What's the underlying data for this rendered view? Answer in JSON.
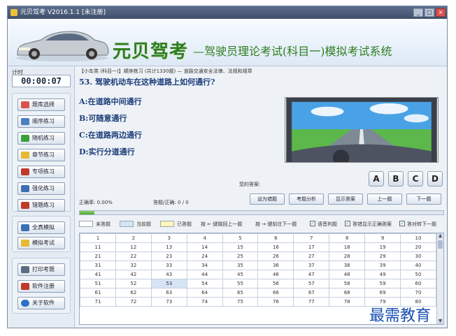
{
  "window": {
    "title": "元贝驾考 V2016.1.1 [未注册]",
    "min": "_",
    "max": "□",
    "close": "×"
  },
  "banner": {
    "brand": "元贝驾考",
    "title": "—驾驶员理论考试(科目一)模拟考试系统"
  },
  "sidebar": {
    "timer_label": "计时",
    "timer": "00:00:07",
    "group1": [
      {
        "label": "题库选择",
        "icon": "bank-icon",
        "color": "#d9534f"
      },
      {
        "label": "顺序练习",
        "icon": "list-icon",
        "color": "#4a7fc1"
      },
      {
        "label": "随机练习",
        "icon": "shuffle-icon",
        "color": "#3aa13a"
      },
      {
        "label": "章节练习",
        "icon": "folder-icon",
        "color": "#e8b92e"
      },
      {
        "label": "专项练习",
        "icon": "check-icon",
        "color": "#c0392b"
      },
      {
        "label": "强化练习",
        "icon": "monitor-icon",
        "color": "#3b6fb5"
      },
      {
        "label": "错题练习",
        "icon": "flag-icon",
        "color": "#c0392b"
      }
    ],
    "group2": [
      {
        "label": "全真模拟",
        "icon": "screen-icon",
        "color": "#3b6fb5"
      },
      {
        "label": "模拟考试",
        "icon": "doc-icon",
        "color": "#e8b92e"
      }
    ],
    "group3": [
      {
        "label": "打印考题",
        "icon": "printer-icon",
        "color": "#5a6b82"
      },
      {
        "label": "软件注册",
        "icon": "wrench-icon",
        "color": "#c0392b"
      },
      {
        "label": "关于软件",
        "icon": "info-icon",
        "color": "#2f6fc4"
      }
    ]
  },
  "main": {
    "breadcrumb": "【小车类 (科目一)】顺序练习 (共计1330题) — 道路交通安全法律、法规和规章",
    "question": "53. 驾驶机动车在这种道路上如何通行?",
    "options": [
      "A:在道路中间通行",
      "B:可随意通行",
      "C:在道路两边通行",
      "D:实行分道通行"
    ],
    "answer_label": "您的答案:",
    "answer_buttons": [
      "A",
      "B",
      "C",
      "D"
    ],
    "accuracy": "正确率: 0.00%",
    "score": "答题/正确: 0 / 0",
    "actions": [
      "设为错题",
      "考题分析",
      "显示答案",
      "上一题",
      "下一题"
    ],
    "progress": 0.04,
    "legend": {
      "unanswered": "未答题",
      "current": "当前题",
      "answered": "已答题",
      "key_hint_prev": "按 ← 键跳回上一题",
      "key_hint_next": "按 → 键前往下一题",
      "opt1": "语音判题",
      "opt2": "答错显示正确答案",
      "opt3": "答对转下一题",
      "colors": {
        "unanswered": "#ffffff",
        "current": "#d6e4f5",
        "answered": "#fff5b8"
      }
    },
    "grid_current": 53,
    "grid_rows": 8,
    "grid_cols": 10
  },
  "watermark": "最需教育"
}
